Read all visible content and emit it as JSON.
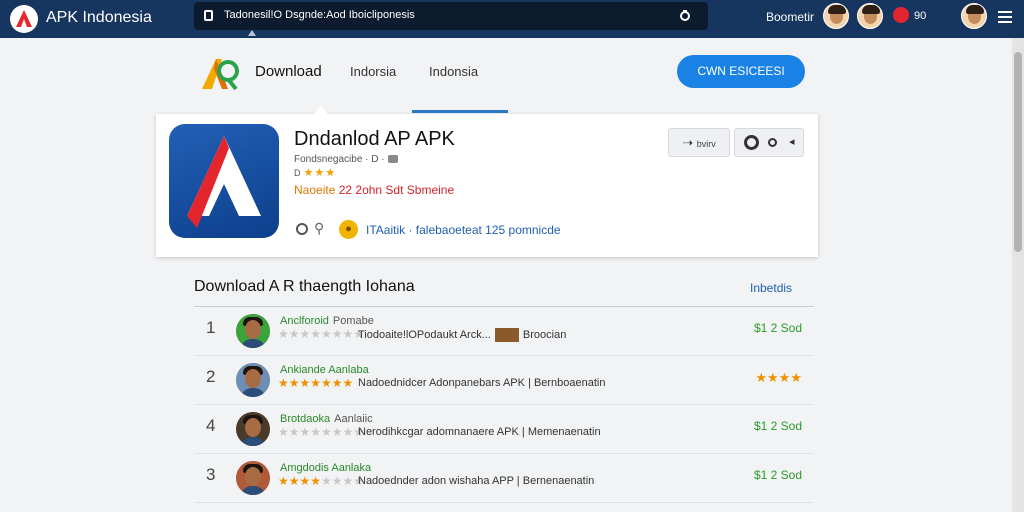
{
  "topbar": {
    "brand": "APK Indonesia",
    "search_text": "Tadonesil!O Dsgnde:Aod Iboicliponesis",
    "account_label": "Boometir",
    "notification_count": "90"
  },
  "header": {
    "nav_download": "Download",
    "nav_link_1": "Indorsia",
    "nav_link_2": "Indonsia",
    "cta_label": "CWN ESICEESI"
  },
  "app": {
    "title": "Dndanlod AP APK",
    "developer": "Fondsnegacibe · D ·",
    "stars_prefix": "D",
    "stars": "★★★",
    "tag_highlight": "Naoeite",
    "tag_rest": " 22 2ohn Sdt Sbmeine",
    "meta": "ITAaitik · falebaoeteat 125 pomnicde",
    "share_label": "bvirv"
  },
  "list": {
    "title": "Download A R thaength Iohana",
    "filter": "Inbetdis",
    "rows": [
      {
        "num": "1",
        "name": "Anclforoid",
        "sub": "Pomabe",
        "desc_a": "Tiodoaite!lOPodaukt Arck...",
        "desc_b": "Broocian",
        "price": "$1 2 Sod",
        "stars_on": "",
        "stars_off": "★★★★★★★★",
        "avatar_bg": "#3aa33a"
      },
      {
        "num": "2",
        "name": "Ankiande Aanlaba",
        "sub": "",
        "desc_a": "Nadoednidcer Adonpanebars APK |",
        "desc_b": "Bernboaenatin",
        "price": "★★★★",
        "stars_on": "★★★★★★★",
        "stars_off": "",
        "avatar_bg": "#6e8fb5"
      },
      {
        "num": "4",
        "name": "Brotdaoka",
        "sub": "Aanlaiic",
        "desc_a": "Nerodihkcgar adomnanaere APK |",
        "desc_b": "Memenaenatin",
        "price": "$1 2 Sod",
        "stars_on": "",
        "stars_off": "★★★★★★★★",
        "avatar_bg": "#4a3a2a"
      },
      {
        "num": "3",
        "name": "Amgdodis Aanlaka",
        "sub": "",
        "desc_a": "Nadoednder adon wishaha APP |",
        "desc_b": "Bernenaenatin",
        "price": "$1 2 Sod",
        "stars_on": "★★★★",
        "stars_off": "★★★★",
        "avatar_bg": "#b05a3a"
      }
    ]
  },
  "colors": {
    "topbar": "#16365f",
    "accent_blue": "#1a82e5",
    "price_green": "#2a9a2a",
    "star_orange": "#f09000"
  },
  "icons": [
    "apk-logo-icon",
    "lock-icon",
    "search-icon",
    "bell-badge-icon",
    "menu-icon",
    "share-icon",
    "settings-icon",
    "chevron-down-icon",
    "coin-icon",
    "pin-icon"
  ]
}
